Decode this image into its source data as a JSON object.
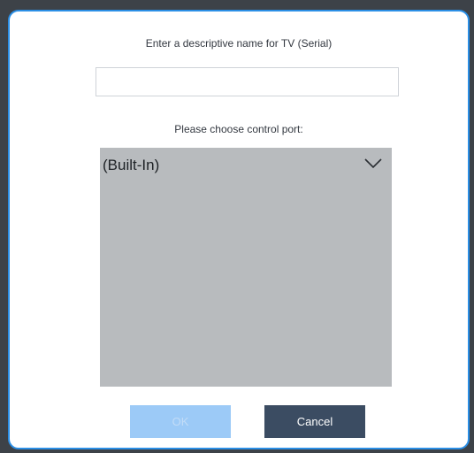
{
  "dialog": {
    "name_prompt": "Enter a descriptive name for TV (Serial)",
    "name_value": "",
    "name_placeholder": "",
    "port_prompt": "Please choose control port:",
    "port_selected": "(Built-In)",
    "ok_label": "OK",
    "cancel_label": "Cancel",
    "ok_enabled": false
  },
  "icons": {
    "dropdown": "chevron-down-icon"
  },
  "colors": {
    "dialog_border": "#2b8fe6",
    "list_background": "#b8bbbe",
    "ok_disabled": "#9ccaf7",
    "cancel_background": "#3b4c62"
  }
}
